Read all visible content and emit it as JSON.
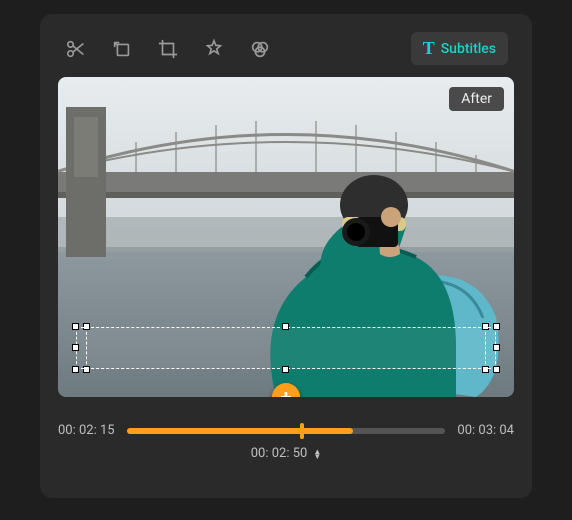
{
  "toolbar": {
    "subtitles_label": "Subtitles"
  },
  "preview": {
    "badge_label": "After"
  },
  "timeline": {
    "start": "00: 02: 15",
    "end": "00: 03: 04",
    "current": "00: 02: 50",
    "progress_percent": 71,
    "playhead_percent": 55
  },
  "colors": {
    "accent": "#ff9e1b",
    "cyan": "#19d3d3"
  }
}
